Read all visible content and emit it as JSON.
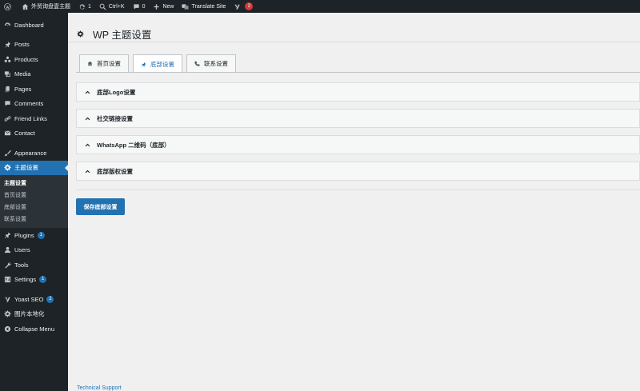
{
  "adminbar": {
    "site_name": "外贸询盘壹主题",
    "updates_count": "1",
    "search_shortcut": "Ctrl+K",
    "comments_count": "0",
    "new_label": "New",
    "translate_label": "Translate Site",
    "yoast_badge": "2"
  },
  "sidebar": {
    "dashboard": "Dashboard",
    "posts": "Posts",
    "products": "Products",
    "media": "Media",
    "pages": "Pages",
    "comments": "Comments",
    "friend_links": "Friend Links",
    "contact": "Contact",
    "appearance": "Appearance",
    "theme_settings": "主题设置",
    "submenu": [
      {
        "label": "主题设置"
      },
      {
        "label": "首页设置"
      },
      {
        "label": "底部设置"
      },
      {
        "label": "联系设置"
      }
    ],
    "plugins": "Plugins",
    "plugins_badge": "1",
    "users": "Users",
    "tools": "Tools",
    "settings": "Settings",
    "settings_badge": "1",
    "yoast": "Yoast SEO",
    "yoast_badge": "2",
    "image_localize": "图片本地化",
    "collapse": "Collapse Menu"
  },
  "main": {
    "title": "WP 主题设置",
    "tabs": [
      {
        "label": "首页设置",
        "icon": "home-icon"
      },
      {
        "label": "底部设置",
        "icon": "pin-icon"
      },
      {
        "label": "联系设置",
        "icon": "phone-icon"
      }
    ],
    "active_tab": 1,
    "panels": [
      {
        "label": "底部Logo设置"
      },
      {
        "label": "社交链接设置"
      },
      {
        "label": "WhatsApp 二维码（底部）"
      },
      {
        "label": "底部版权设置"
      }
    ],
    "save_label": "保存底部设置",
    "support_link": "Technical Support"
  },
  "colors": {
    "accent": "#2271b1",
    "adminbar_bg": "#1d2327",
    "badge_red": "#d63638"
  }
}
